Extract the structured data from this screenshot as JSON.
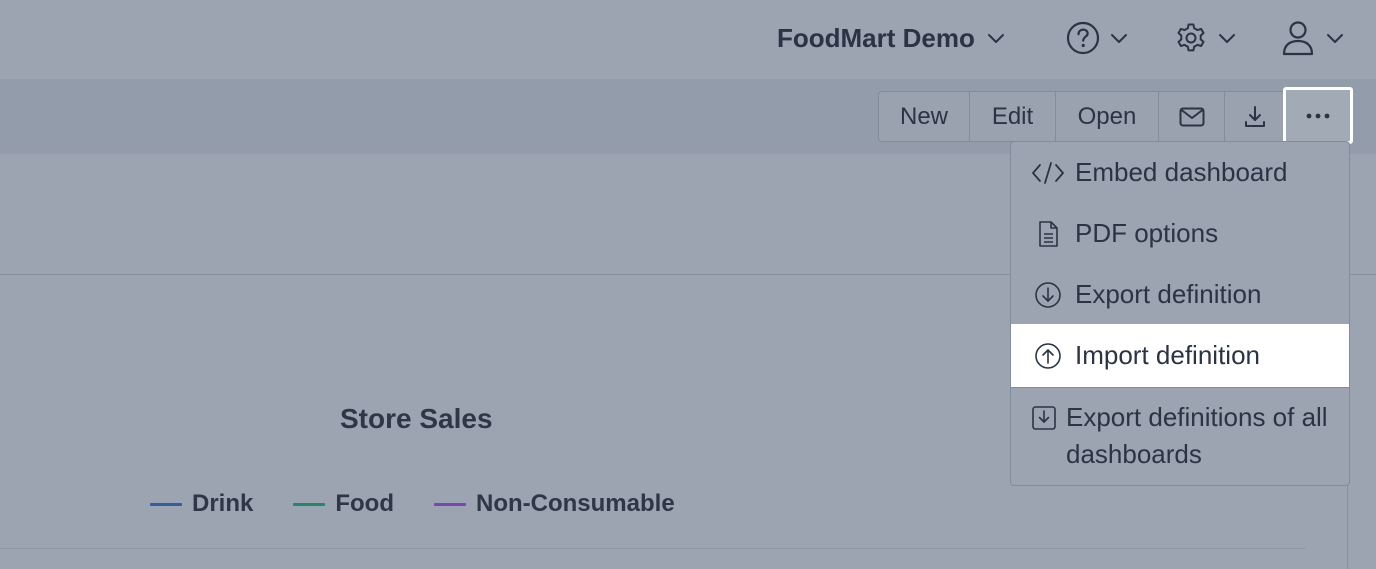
{
  "header": {
    "org_name": "FoodMart Demo",
    "help_icon": "help-circle-icon",
    "settings_icon": "gear-icon",
    "user_icon": "user-icon"
  },
  "toolbar": {
    "new_label": "New",
    "edit_label": "Edit",
    "open_label": "Open",
    "email_icon": "envelope-icon",
    "download_icon": "download-icon",
    "more_icon": "ellipsis-icon"
  },
  "menu": {
    "items": [
      {
        "label": "Embed dashboard",
        "icon": "code-icon"
      },
      {
        "label": "PDF options",
        "icon": "document-icon"
      },
      {
        "label": "Export definition",
        "icon": "arrow-down-circle-icon"
      },
      {
        "label": "Import definition",
        "icon": "arrow-up-circle-icon",
        "selected": true
      },
      {
        "label": "Export definitions of all dashboards",
        "icon": "download-square-icon"
      }
    ]
  },
  "chart_data": {
    "type": "line",
    "title": "Store Sales",
    "series": [
      {
        "name": "Drink",
        "color": "#2f5ea3"
      },
      {
        "name": "Food",
        "color": "#1e8a6a"
      },
      {
        "name": "Non-Consumable",
        "color": "#7a45b8"
      }
    ],
    "legend": "top-center"
  },
  "colors": {
    "overlay_bg": "#9ca3b1",
    "toolbar_band": "#939cab",
    "text": "#2b3445",
    "highlight": "#ffffff"
  }
}
